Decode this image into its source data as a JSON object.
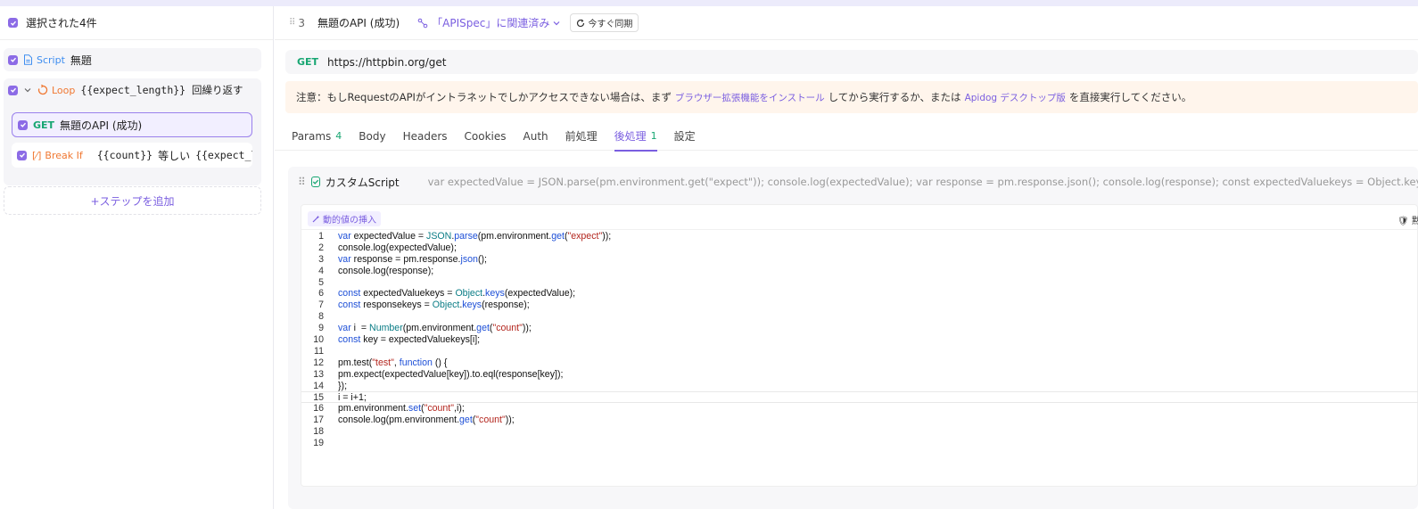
{
  "sidebar": {
    "selection_title": "選択された4件",
    "steps": [
      {
        "tag": "Script",
        "name": "無題"
      },
      {
        "tag": "Loop",
        "name": "{{expect_length}} 回繰り返す"
      },
      {
        "tag": "GET",
        "name": "無題のAPI (成功)"
      },
      {
        "tag": "Break If",
        "name_a": "{{count}}",
        "op": "等しい",
        "name_b": "{{expect_le"
      }
    ],
    "add_step_label": "+ステップを追加"
  },
  "header": {
    "id": "3",
    "title": "無題のAPI (成功)",
    "link_label": "「APISpec」に関連済み",
    "sync_label": "今すぐ同期"
  },
  "url": {
    "method": "GET",
    "value": "https://httpbin.org/get"
  },
  "notice": {
    "part1": "注意：もしRequestのAPIがイントラネットでしかアクセスできない場合は、まず",
    "link1": "ブラウザー拡張機能をインストール",
    "part2": "してから実行するか、または",
    "link2": "Apidog デスクトップ版",
    "part3": "を直接実行してください。"
  },
  "tabs": [
    {
      "label": "Params",
      "count": "4"
    },
    {
      "label": "Body",
      "count": ""
    },
    {
      "label": "Headers",
      "count": ""
    },
    {
      "label": "Cookies",
      "count": ""
    },
    {
      "label": "Auth",
      "count": ""
    },
    {
      "label": "前処理",
      "count": ""
    },
    {
      "label": "後処理",
      "count": "1"
    },
    {
      "label": "設定",
      "count": ""
    }
  ],
  "script": {
    "name": "カスタムScript",
    "preview": "var expectedValue = JSON.parse(pm.environment.get(\"expect\")); console.log(expectedValue); var response = pm.response.json(); console.log(response); const expectedValuekeys = Object.keys(expected",
    "insert_label": "動的値の挿入",
    "right_label": "🛡 黙"
  },
  "code_lines": [
    "var expectedValue = JSON.parse(pm.environment.get(\"expect\"));",
    "console.log(expectedValue);",
    "var response = pm.response.json();",
    "console.log(response);",
    "",
    "const expectedValuekeys = Object.keys(expectedValue);",
    "const responsekeys = Object.keys(response);",
    "",
    "var i  = Number(pm.environment.get(\"count\"));",
    "const key = expectedValuekeys[i];",
    "",
    "pm.test(\"test\", function () {",
    "pm.expect(expectedValue[key]).to.eql(response[key]);",
    "});",
    "i = i+1;",
    "pm.environment.set(\"count\",i);",
    "console.log(pm.environment.get(\"count\"));",
    "",
    ""
  ],
  "colors": {
    "accent": "#7a5ee0",
    "get": "#17a672",
    "orange": "#f07832",
    "script": "#3f8ef0"
  }
}
